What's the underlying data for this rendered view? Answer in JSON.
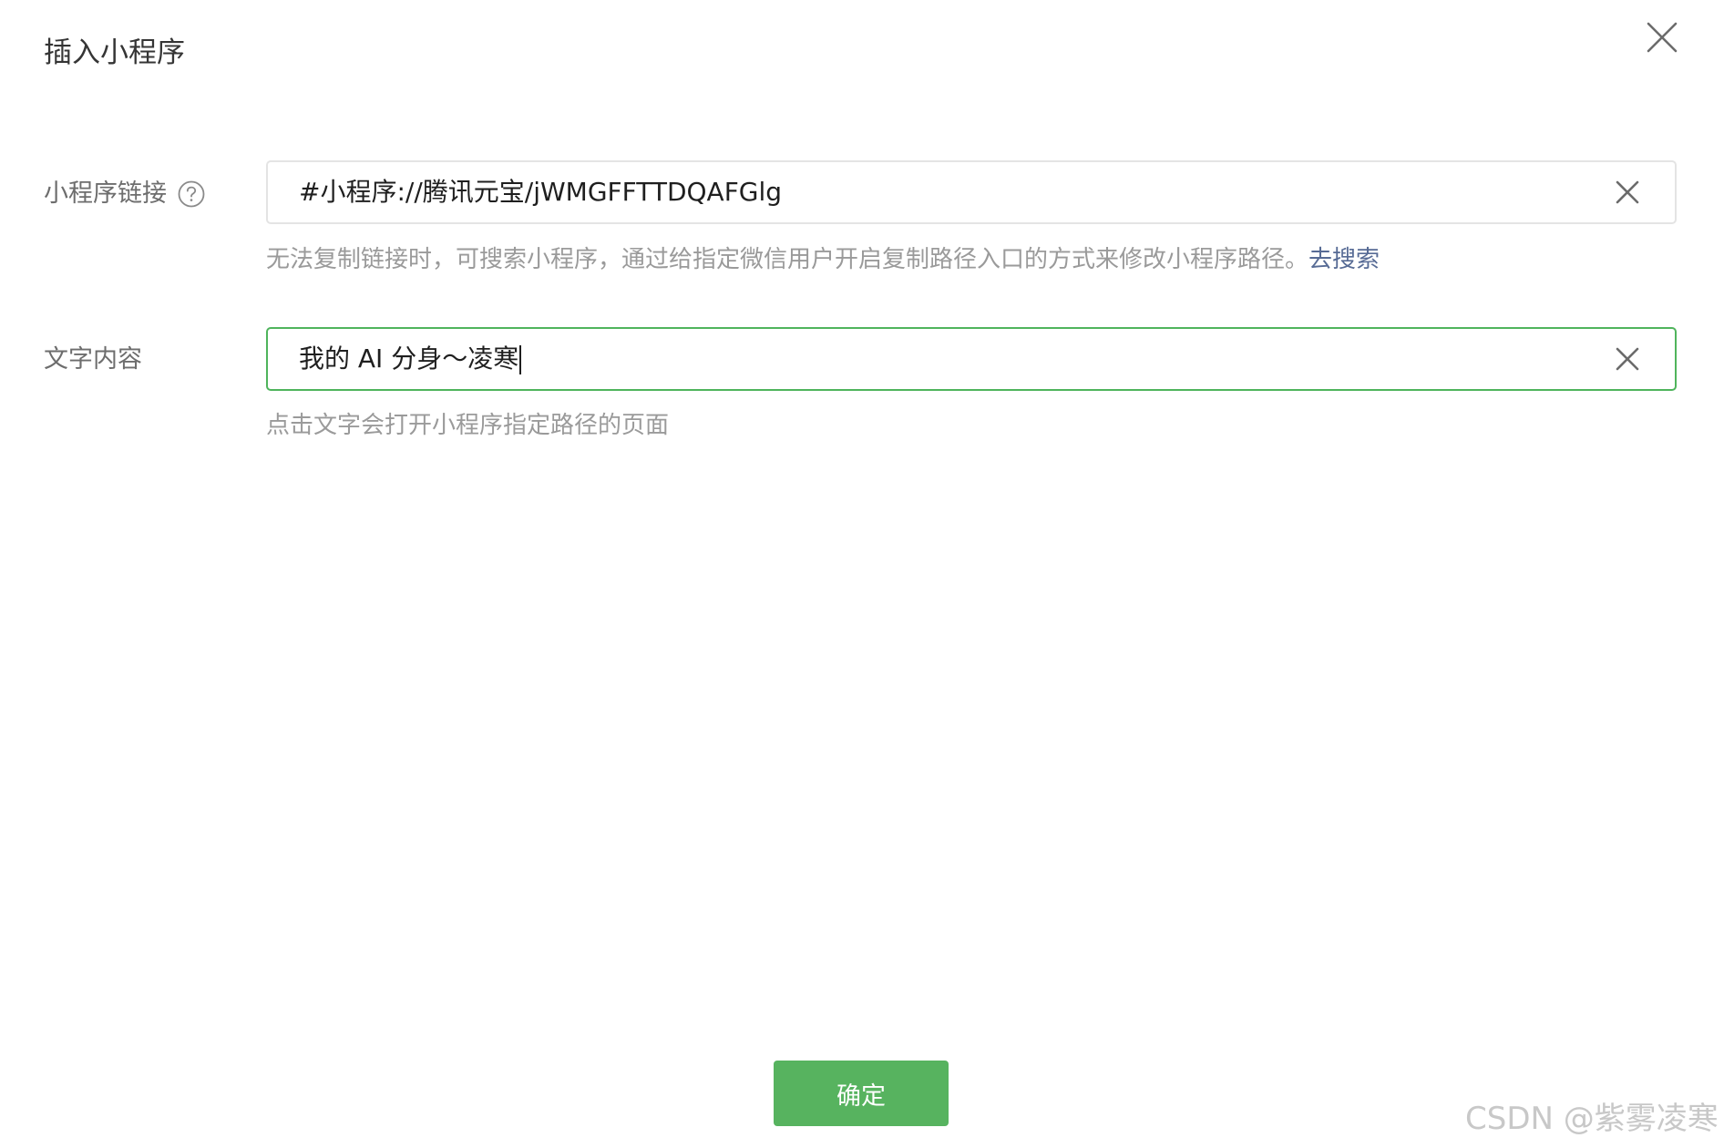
{
  "dialog": {
    "title": "插入小程序"
  },
  "link_field": {
    "label": "小程序链接",
    "value": "#小程序://腾讯元宝/jWMGFFTTDQAFGlg",
    "hint": "无法复制链接时，可搜索小程序，通过给指定微信用户开启复制路径入口的方式来修改小程序路径。",
    "hint_link": "去搜索"
  },
  "text_field": {
    "label": "文字内容",
    "value": "我的 AI 分身～凌寒",
    "hint": "点击文字会打开小程序指定路径的页面"
  },
  "footer": {
    "confirm_label": "确定"
  },
  "watermark": "CSDN @紫雾凌寒",
  "colors": {
    "accent_green": "#57b35f",
    "focus_border": "#4fb45c",
    "link_blue": "#576b95"
  },
  "icons": {
    "close": "close-icon",
    "help": "question-circle-icon",
    "clear": "clear-icon"
  }
}
